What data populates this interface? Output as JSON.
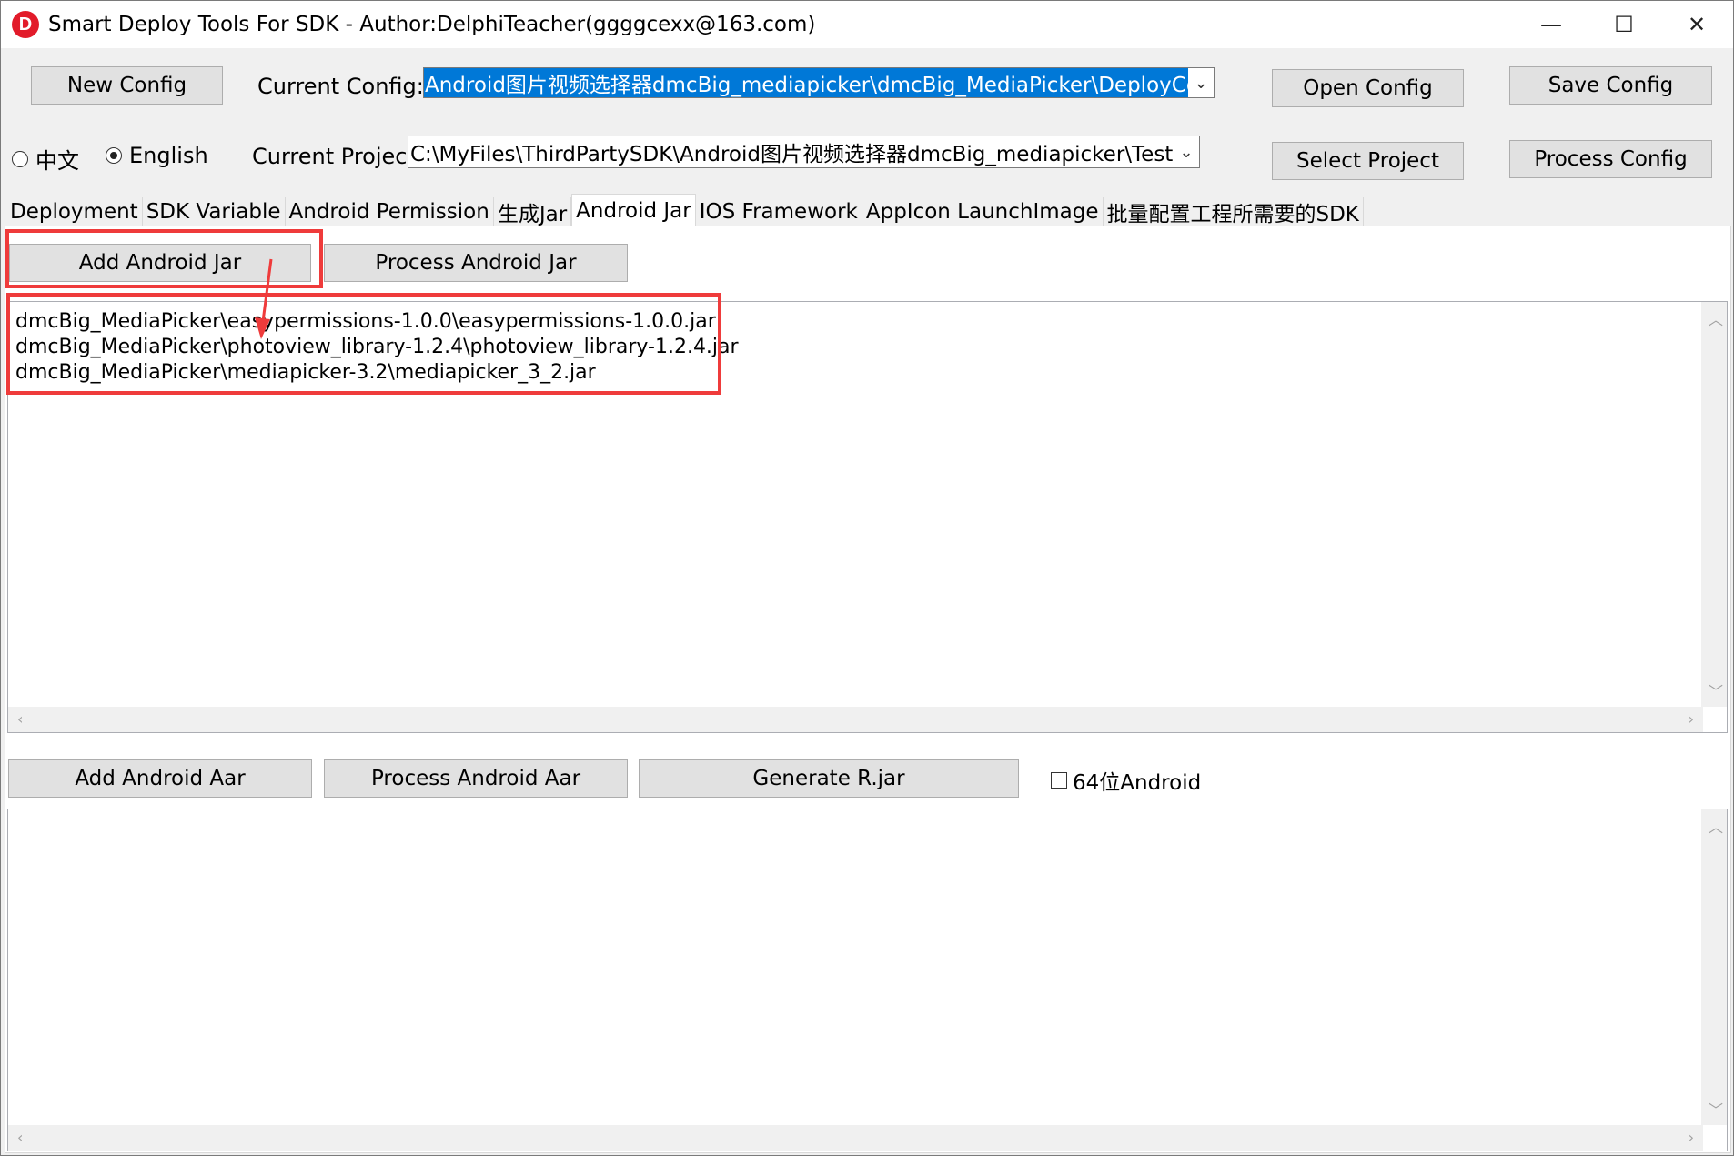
{
  "window": {
    "title": "Smart Deploy Tools For SDK - Author:DelphiTeacher(ggggcexx@163.com)",
    "logo_letter": "D",
    "controls": {
      "minimize": "—",
      "maximize": "☐",
      "close": "✕"
    }
  },
  "toolbar": {
    "new_config": "New Config",
    "current_config_label": "Current Config:",
    "current_config_value": "Android图片视频选择器dmcBig_mediapicker\\dmcBig_MediaPicker\\DeployConfig.ini",
    "open_config": "Open Config",
    "save_config": "Save Config",
    "lang_chinese": "中文",
    "lang_english": "English",
    "selected_language": "English",
    "current_project_label": "Current Project:",
    "current_project_value": "C:\\MyFiles\\ThirdPartySDK\\Android图片视频选择器dmcBig_mediapicker\\TestMediaPicker",
    "select_project": "Select Project",
    "process_config": "Process Config"
  },
  "tabs": [
    {
      "label": "Deployment",
      "active": false
    },
    {
      "label": "SDK Variable",
      "active": false
    },
    {
      "label": "Android Permission",
      "active": false
    },
    {
      "label": "生成Jar",
      "active": false
    },
    {
      "label": "Android Jar",
      "active": true
    },
    {
      "label": "IOS Framework",
      "active": false
    },
    {
      "label": "AppIcon LaunchImage",
      "active": false
    },
    {
      "label": "批量配置工程所需要的SDK",
      "active": false
    }
  ],
  "jar_section": {
    "add_button": "Add Android Jar",
    "process_button": "Process Android Jar",
    "files": [
      "dmcBig_MediaPicker\\easypermissions-1.0.0\\easypermissions-1.0.0.jar",
      "dmcBig_MediaPicker\\photoview_library-1.2.4\\photoview_library-1.2.4.jar",
      "dmcBig_MediaPicker\\mediapicker-3.2\\mediapicker_3_2.jar"
    ]
  },
  "aar_section": {
    "add_button": "Add Android Aar",
    "process_button": "Process Android Aar",
    "generate_button": "Generate R.jar",
    "checkbox_64bit": "64位Android",
    "checkbox_64bit_checked": false,
    "files": []
  },
  "colors": {
    "annotation_red": "#ef3b3b",
    "selection_blue": "#0078d7",
    "logo_red": "#e21b2a"
  }
}
